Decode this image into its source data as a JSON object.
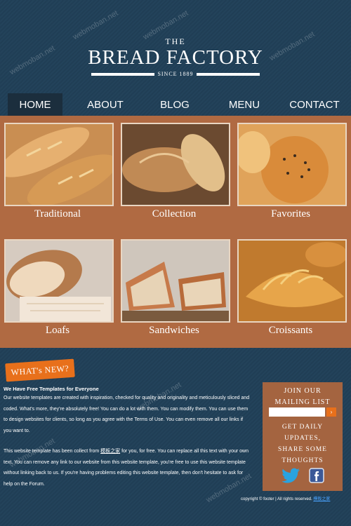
{
  "header": {
    "the": "THE",
    "title": "BREAD FACTORY",
    "since": "SINCE 1889"
  },
  "nav": {
    "items": [
      {
        "label": "HOME",
        "active": true
      },
      {
        "label": "ABOUT",
        "active": false
      },
      {
        "label": "BLOG",
        "active": false
      },
      {
        "label": "MENU",
        "active": false
      },
      {
        "label": "CONTACT",
        "active": false
      }
    ]
  },
  "gallery": {
    "items": [
      {
        "caption": "Traditional"
      },
      {
        "caption": "Collection"
      },
      {
        "caption": "Favorites"
      },
      {
        "caption": "Loafs"
      },
      {
        "caption": "Sandwiches"
      },
      {
        "caption": "Croissants"
      }
    ]
  },
  "whats_new": {
    "badge": "WHAT's NEW?",
    "heading": "We Have Free Templates for Everyone",
    "para1": "Our website templates are created with inspiration, checked for quality and originality and meticulously sliced and coded. What's more, they're absolutely free! You can do a lot with them. You can modify them. You can use them to design websites for clients, so long as you agree with the Terms of Use. You can even remove all our links if you want to.",
    "para2_before": "This website template has been collect from ",
    "para2_link": "模板之家",
    "para2_after": " for you, for free. You can replace all this text with your own text. You can remove any link to our website from this website template, you're free to use this website template without linking back to us. If you're having problems editing this website template, then don't hesitate to ask for help on the Forum."
  },
  "sidebar": {
    "join": "JOIN OUR",
    "mailing": "MAILING LIST",
    "email_placeholder": "",
    "go": "›",
    "updates1": "GET DAILY",
    "updates2": "UPDATES,",
    "updates3": "SHARE SOME",
    "updates4": "THOUGHTS"
  },
  "footer": {
    "text": "copyright © footer | All rights reserved.",
    "link": "模板之家"
  },
  "watermark": "webmoban.net",
  "colors": {
    "background": "#1f3d54",
    "panel": "#b06a42",
    "accent": "#e8701b",
    "twitter": "#29a3e0",
    "facebook": "#3b5998"
  }
}
